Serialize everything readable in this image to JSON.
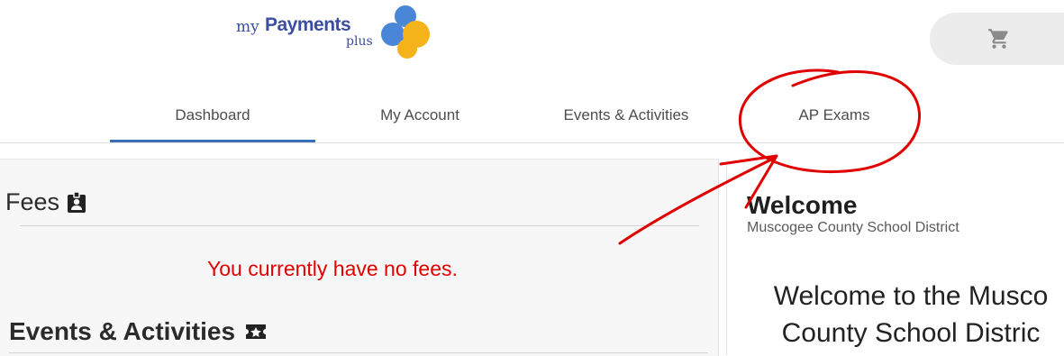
{
  "header": {
    "logo": {
      "my": "my",
      "payments": "Payments",
      "plus": "plus"
    },
    "cart": {
      "icon": "shopping-cart-icon"
    }
  },
  "nav": {
    "tabs": [
      {
        "label": "Dashboard",
        "active": true
      },
      {
        "label": "My Account",
        "active": false
      },
      {
        "label": "Events & Activities",
        "active": false
      },
      {
        "label": "AP Exams",
        "active": false
      }
    ],
    "accent_color": "#3a6fb4"
  },
  "fees": {
    "title": "Fees",
    "icon": "id-badge-icon",
    "empty_message": "You currently have no fees.",
    "empty_color": "#e20000"
  },
  "events": {
    "title": "Events & Activities",
    "icon": "ticket-star-icon"
  },
  "welcome": {
    "title": "Welcome",
    "subtitle": "Muscogee County School District",
    "body_line1": "Welcome to the Musco",
    "body_line2": "County School Distric"
  },
  "annotation": {
    "color": "#e00000",
    "shapes": [
      "circle-around-ap-exams",
      "arrow-pointing-to-ap-exams"
    ]
  }
}
